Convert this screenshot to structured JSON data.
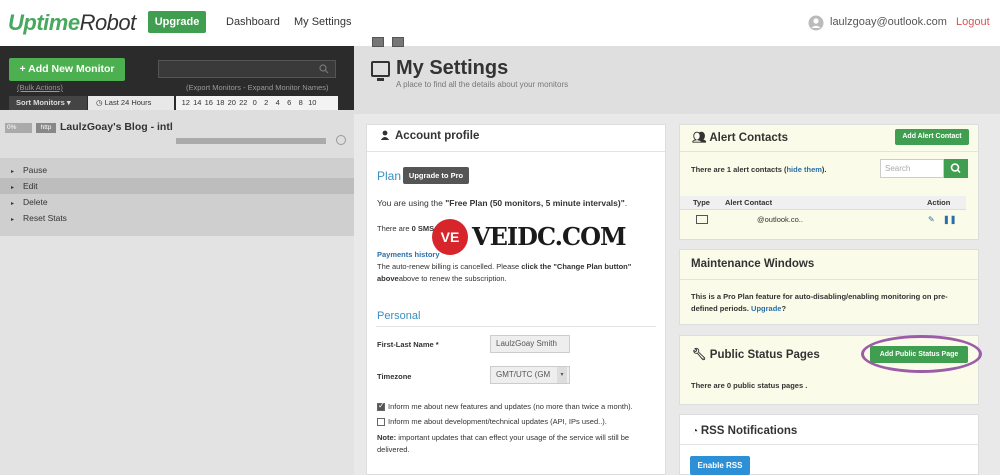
{
  "nav": {
    "logo_part1": "Uptime",
    "logo_part2": "Robot",
    "upgrade": "Upgrade",
    "dashboard": "Dashboard",
    "my_settings": "My Settings",
    "user_email": "laulzgoay@outlook.com",
    "logout": "Logout"
  },
  "sidebar": {
    "add_monitor": "+ Add New Monitor",
    "bulk_actions": "(Bulk Actions)",
    "export_expand": "(Export Monitors - Expand Monitor Names)",
    "sort_monitors": "Sort Monitors ▾",
    "last_24": "Last 24 Hours",
    "hours": [
      "12",
      "14",
      "16",
      "18",
      "20",
      "22",
      "0",
      "2",
      "4",
      "6",
      "8",
      "10"
    ],
    "monitor": {
      "percent": "0%",
      "type": "http",
      "name": "LaulzGoay's Blog - intl"
    },
    "menu": [
      "Pause",
      "Edit",
      "Delete",
      "Reset Stats"
    ]
  },
  "page": {
    "title": "My Settings",
    "subtitle": "A place to find all the details about your monitors"
  },
  "account": {
    "title": "Account profile",
    "plan_label": "Plan",
    "upgrade_pro": "Upgrade to Pro",
    "plan_text_prefix": "You are using the ",
    "plan_text_bold": "\"Free Plan (50 monitors, 5 minute intervals)\"",
    "plan_text_suffix": ".",
    "sms_text_a": "There are ",
    "sms_text_b": "0 SMS",
    "payments_history": "Payments history",
    "renew_text_a": "The auto-renew billing is cancelled. Please ",
    "renew_text_b": "click the \"Change Plan button\"",
    "renew_text_c": "above to renew the subscription.",
    "personal": "Personal",
    "first_last_label": "First-Last Name *",
    "first_last_value": "LaulzGoay Smith",
    "timezone_label": "Timezone",
    "timezone_value": "GMT/UTC (GM",
    "check1": "Inform me about new features and updates (no more than twice a month).",
    "check2": "Inform me about development/technical updates (API, IPs used..).",
    "note_label": "Note:",
    "note_text": "important updates that can effect your usage of the service will still be delivered."
  },
  "alerts": {
    "title": "Alert Contacts",
    "add_button": "Add Alert Contact",
    "summary_a": "There are 1 alert contacts (",
    "summary_link_1": "hide",
    "summary_link_2": "them",
    "summary_b": ").",
    "search_placeholder": "Search",
    "col_type": "Type",
    "col_contact": "Alert Contact",
    "col_action": "Action",
    "row_contact": "@outlook.co.."
  },
  "maintenance": {
    "title": "Maintenance Windows",
    "text_a": "This is a Pro Plan feature for auto-disabling/enabling monitoring on pre-defined periods.",
    "upgrade_link": "Upgrade",
    "text_b": "?"
  },
  "status_pages": {
    "title": "Public Status Pages",
    "add_button": "Add Public Status Page",
    "text": "There are 0 public status pages ."
  },
  "rss": {
    "title": "RSS Notifications",
    "enable": "Enable RSS"
  },
  "watermark": {
    "circle_text": "VE",
    "text": "VEIDC.COM"
  }
}
